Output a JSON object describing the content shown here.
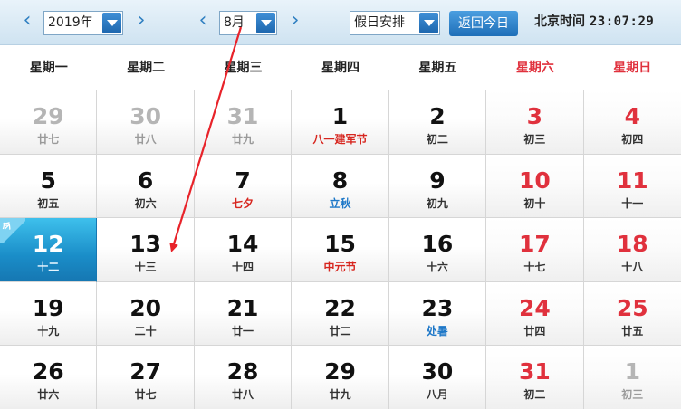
{
  "toolbar": {
    "prev_year_icon": "chevron-left-icon",
    "year_value": "2019年",
    "next_year_icon": "chevron-right-icon",
    "prev_month_icon": "chevron-left-icon",
    "month_value": "8月",
    "next_month_icon": "chevron-right-icon",
    "holiday_value": "假日安排",
    "today_button": "返回今日",
    "clock_label": "北京时间",
    "clock_time": "23:07:29"
  },
  "weekdays": [
    "星期一",
    "星期二",
    "星期三",
    "星期四",
    "星期五",
    "星期六",
    "星期日"
  ],
  "today_tag": "今",
  "colors": {
    "accent": "#1f6fb8",
    "weekend_red": "#e0313d",
    "festival_red": "#d7261f",
    "solar_term_blue": "#1e78c8",
    "today_bg": "#1a8dc8"
  },
  "weeks": [
    [
      {
        "day": "29",
        "lunar": "廿七",
        "other": true
      },
      {
        "day": "30",
        "lunar": "廿八",
        "other": true
      },
      {
        "day": "31",
        "lunar": "廿九",
        "other": true
      },
      {
        "day": "1",
        "lunar": "八一建军节",
        "style": "festival"
      },
      {
        "day": "2",
        "lunar": "初二"
      },
      {
        "day": "3",
        "lunar": "初三"
      },
      {
        "day": "4",
        "lunar": "初四"
      }
    ],
    [
      {
        "day": "5",
        "lunar": "初五"
      },
      {
        "day": "6",
        "lunar": "初六"
      },
      {
        "day": "7",
        "lunar": "七夕",
        "style": "festival"
      },
      {
        "day": "8",
        "lunar": "立秋",
        "style": "term"
      },
      {
        "day": "9",
        "lunar": "初九"
      },
      {
        "day": "10",
        "lunar": "初十"
      },
      {
        "day": "11",
        "lunar": "十一"
      }
    ],
    [
      {
        "day": "12",
        "lunar": "十二",
        "today": true
      },
      {
        "day": "13",
        "lunar": "十三"
      },
      {
        "day": "14",
        "lunar": "十四"
      },
      {
        "day": "15",
        "lunar": "中元节",
        "style": "festival"
      },
      {
        "day": "16",
        "lunar": "十六"
      },
      {
        "day": "17",
        "lunar": "十七"
      },
      {
        "day": "18",
        "lunar": "十八"
      }
    ],
    [
      {
        "day": "19",
        "lunar": "十九"
      },
      {
        "day": "20",
        "lunar": "二十"
      },
      {
        "day": "21",
        "lunar": "廿一"
      },
      {
        "day": "22",
        "lunar": "廿二"
      },
      {
        "day": "23",
        "lunar": "处暑",
        "style": "term"
      },
      {
        "day": "24",
        "lunar": "廿四"
      },
      {
        "day": "25",
        "lunar": "廿五"
      }
    ],
    [
      {
        "day": "26",
        "lunar": "廿六"
      },
      {
        "day": "27",
        "lunar": "廿七"
      },
      {
        "day": "28",
        "lunar": "廿八"
      },
      {
        "day": "29",
        "lunar": "廿九"
      },
      {
        "day": "30",
        "lunar": "八月"
      },
      {
        "day": "31",
        "lunar": "初二"
      },
      {
        "day": "1",
        "lunar": "初三",
        "other": true
      }
    ]
  ]
}
